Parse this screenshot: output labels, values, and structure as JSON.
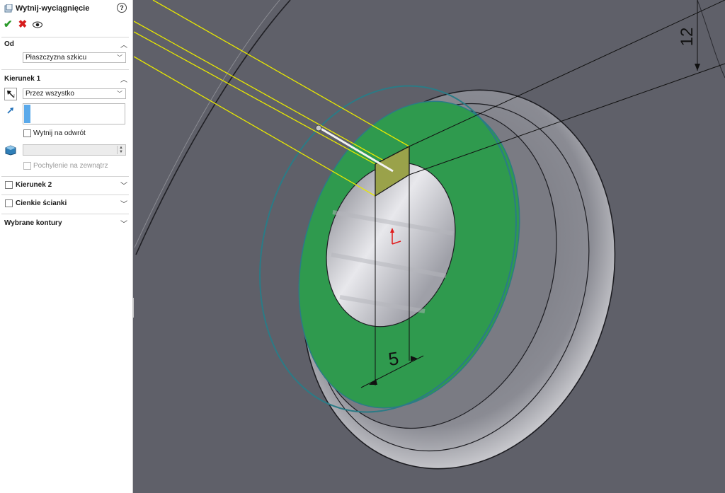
{
  "feature": {
    "title": "Wytnij-wyciągnięcie",
    "help_icon": "question-icon",
    "ok_icon": "checkmark-icon",
    "cancel_icon": "x-icon",
    "preview_icon": "eye-icon"
  },
  "from_section": {
    "label": "Od",
    "selected": "Płaszczyzna szkicu"
  },
  "direction1": {
    "label": "Kierunek 1",
    "end_condition": "Przez wszystko",
    "flip_label": "Wytnij na odwrót",
    "draft_outward_label": "Pochylenie na zewnątrz"
  },
  "direction2": {
    "label": "Kierunek 2"
  },
  "thin": {
    "label": "Cienkie ścianki"
  },
  "contours": {
    "label": "Wybrane kontury"
  },
  "viewport": {
    "dim_vertical": "12",
    "dim_width": "5",
    "colors": {
      "background": "#5f6069",
      "face_green": "#2f9a4e",
      "sketch_yellow": "#e8e800"
    }
  }
}
